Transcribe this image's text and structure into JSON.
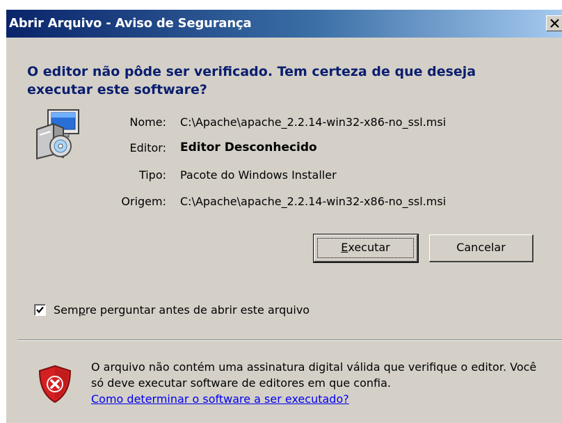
{
  "window": {
    "title": "Abrir Arquivo - Aviso de Segurança"
  },
  "dialog": {
    "question": "O editor não pôde ser verificado.  Tem certeza de que deseja executar este software?",
    "details": [
      {
        "label": "Nome:",
        "value": "C:\\Apache\\apache_2.2.14-win32-x86-no_ssl.msi"
      },
      {
        "label": "Editor:",
        "value": "Editor Desconhecido"
      },
      {
        "label": "Tipo:",
        "value": "Pacote do Windows Installer"
      },
      {
        "label": "Origem:",
        "value": "C:\\Apache\\apache_2.2.14-win32-x86-no_ssl.msi"
      }
    ],
    "buttons": {
      "run_prefix": "E",
      "run_rest": "xecutar",
      "cancel": "Cancelar"
    },
    "checkbox": {
      "checked": true,
      "label_before": "Sem",
      "label_mnemonic": "p",
      "label_after": "re perguntar antes de abrir este arquivo"
    },
    "warning": {
      "text": "O arquivo não contém uma assinatura digital válida que verifique o editor. Você só deve executar software de editores em que confia.",
      "link": "Como determinar o software a ser executado?"
    }
  },
  "icons": {
    "installer": "windows-installer-package-icon",
    "shield": "security-shield-error-icon",
    "close": "close-icon",
    "check": "checkmark-icon"
  },
  "colors": {
    "title_gradient_start": "#0a246a",
    "title_gradient_end": "#a6caf0",
    "question_text": "#0a1e6e",
    "dialog_face": "#d4d0c8",
    "link": "#0000ee",
    "shield_red": "#d42020"
  }
}
